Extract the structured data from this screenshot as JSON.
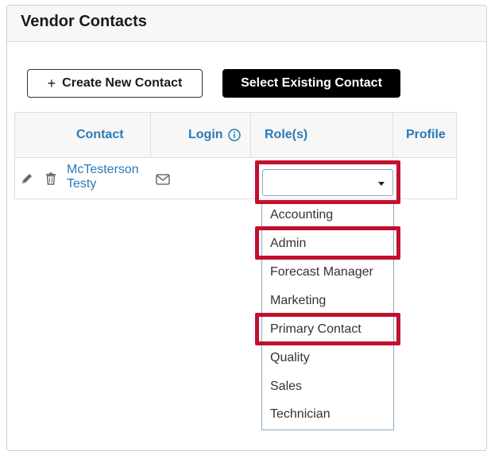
{
  "panel": {
    "title": "Vendor Contacts"
  },
  "buttons": {
    "create_icon": "+",
    "create_label": "Create New Contact",
    "select_label": "Select Existing Contact"
  },
  "table": {
    "headers": {
      "contact": "Contact",
      "login": "Login",
      "roles": "Role(s)",
      "profile": "Profile"
    },
    "rows": [
      {
        "name": "McTesterson Testy",
        "role": ""
      }
    ]
  },
  "dropdown": {
    "options": [
      "Accounting",
      "Admin",
      "Forecast Manager",
      "Marketing",
      "Primary Contact",
      "Quality",
      "Sales",
      "Technician"
    ],
    "highlighted": [
      "Admin",
      "Primary Contact"
    ]
  },
  "icons": {
    "edit": "pencil-icon",
    "delete": "trash-icon",
    "email": "envelope-icon",
    "info": "info-icon",
    "caret": "caret-down-icon"
  },
  "colors": {
    "link": "#2a7ab8",
    "highlight": "#c2102f",
    "primary_button": "#000000"
  }
}
